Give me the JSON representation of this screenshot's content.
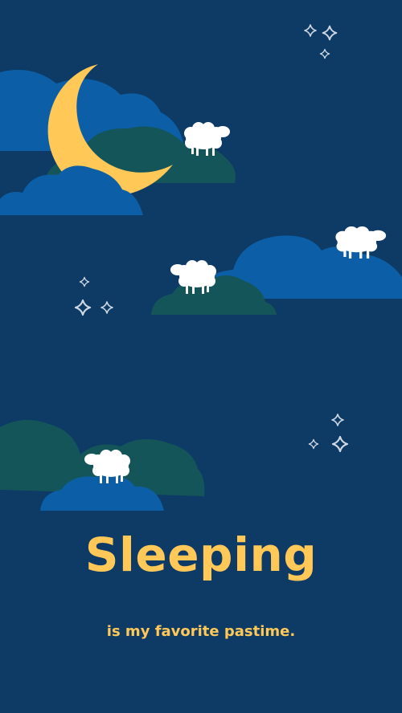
{
  "poster": {
    "title": "Sleeping",
    "subtitle": "is my favorite pastime."
  },
  "colors": {
    "background": "#0e3a66",
    "cloud_blue": "#0c5fa6",
    "cloud_teal": "#14555a",
    "moon": "#ffc857",
    "text": "#ffc857",
    "sheep": "#ffffff",
    "star": "#cfd8e3"
  },
  "icons": [
    "crescent-moon-icon",
    "sheep-icon",
    "cloud-icon",
    "sparkle-star-icon"
  ]
}
